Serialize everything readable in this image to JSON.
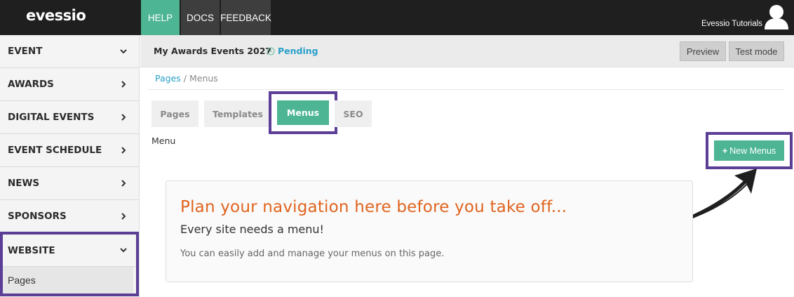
{
  "brand": {
    "logo_text": "evessio"
  },
  "topnav": {
    "help": "HELP",
    "docs": "DOCS",
    "feedback": "FEEDBACK",
    "user_name": "Evessio Tutorials"
  },
  "sidebar": {
    "items": [
      {
        "label": "EVENT",
        "chevron": "chevron-down"
      },
      {
        "label": "AWARDS",
        "chevron": "chevron-right"
      },
      {
        "label": "DIGITAL EVENTS",
        "chevron": "chevron-right"
      },
      {
        "label": "EVENT SCHEDULE",
        "chevron": "chevron-right"
      },
      {
        "label": "NEWS",
        "chevron": "chevron-right"
      },
      {
        "label": "SPONSORS",
        "chevron": "chevron-right"
      }
    ],
    "website": {
      "label": "WEBSITE",
      "chevron": "chevron-down",
      "sub_item": "Pages"
    }
  },
  "header": {
    "event_title": "My Awards Events 2027",
    "status": "Pending",
    "preview_button": "Preview",
    "test_mode_button": "Test mode"
  },
  "breadcrumb": {
    "parent": "Pages",
    "separator": "/",
    "current": "Menus"
  },
  "tabs": [
    {
      "label": "Pages",
      "active": false
    },
    {
      "label": "Templates",
      "active": false
    },
    {
      "label": "Menus",
      "active": true
    },
    {
      "label": "SEO",
      "active": false
    }
  ],
  "menu_label": "Menu",
  "new_button": {
    "icon": "+",
    "label": "New Menus"
  },
  "card": {
    "title": "Plan your navigation here before you take off...",
    "subtitle": "Every site needs a menu!",
    "text": "You can easily add and manage your menus on this page."
  },
  "colors": {
    "accent": "#4db594",
    "highlight_frame": "#5b3e96",
    "status": "#2a9fc9",
    "card_title": "#e0641e",
    "topbar": "#1f1f1f"
  }
}
